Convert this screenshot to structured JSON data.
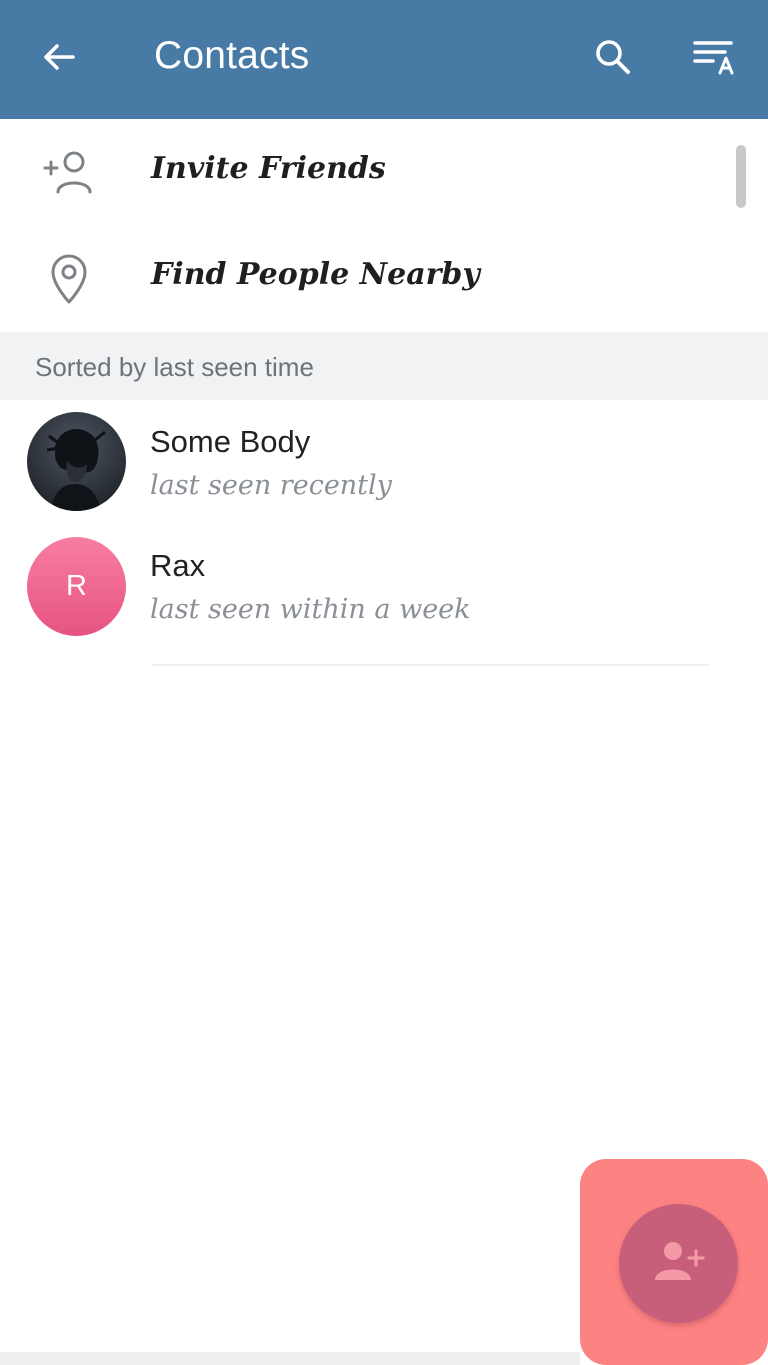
{
  "header": {
    "title": "Contacts",
    "color": "#477ba5",
    "icons": [
      "arrow-back-icon",
      "search-icon",
      "sort-by-name-icon"
    ]
  },
  "actions": [
    {
      "label": "Invite Friends",
      "icon": "add-person-icon"
    },
    {
      "label": "Find People Nearby",
      "icon": "location-pin-icon"
    }
  ],
  "section": {
    "title": "Sorted by last seen time"
  },
  "contacts": [
    {
      "name": "Some Body",
      "status": "last seen recently",
      "avatar": "photo"
    },
    {
      "name": "Rax",
      "status": "last seen within a week",
      "avatar_letter": "R",
      "avatar_color": "#f06a91"
    }
  ],
  "fab": {
    "icon": "add-contact-icon",
    "color": "#c85f7a",
    "highlight_color": "#fd8383"
  }
}
